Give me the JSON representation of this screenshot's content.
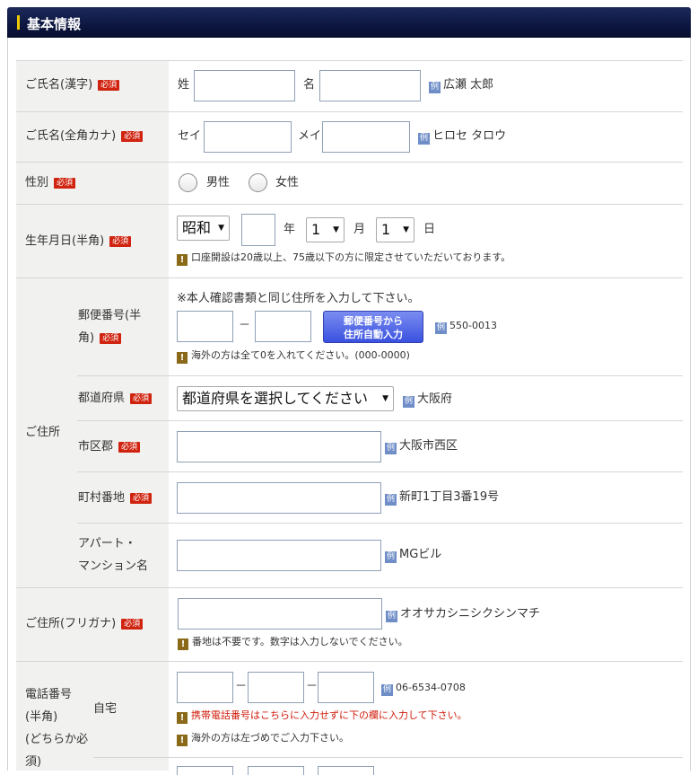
{
  "section_title": "基本情報",
  "required_badge": "必須",
  "example_badge": "例",
  "warn_badge": "!",
  "name_kanji": {
    "label": "ご氏名(漢字)",
    "last_prefix": "姓",
    "first_prefix": "名",
    "example": "広瀬 太郎"
  },
  "name_kana": {
    "label": "ご氏名(全角カナ)",
    "last_prefix": "セイ",
    "first_prefix": "メイ",
    "example": "ヒロセ タロウ"
  },
  "gender": {
    "label": "性別",
    "options": [
      "男性",
      "女性"
    ]
  },
  "birthdate": {
    "label": "生年月日(半角)",
    "era": "昭和",
    "year_unit": "年",
    "month": "1",
    "month_unit": "月",
    "day": "1",
    "day_unit": "日",
    "note": "口座開設は20歳以上、75歳以下の方に限定させていただいております。"
  },
  "address": {
    "label": "ご住所",
    "postal": {
      "label_line1": "郵便番号(半",
      "label_line2": "角)",
      "instruction": "※本人確認書類と同じ住所を入力して下さい。",
      "separator": "－",
      "button_line1": "郵便番号から",
      "button_line2": "住所自動入力",
      "example": "550-0013",
      "note": "海外の方は全て0を入れてください。(000-0000)"
    },
    "prefecture": {
      "label": "都道府県",
      "selected": "都道府県を選択してください",
      "example": "大阪府"
    },
    "city": {
      "label": "市区郡",
      "example": "大阪市西区"
    },
    "town": {
      "label": "町村番地",
      "example": "新町1丁目3番19号"
    },
    "building": {
      "label_line1": "アパート・",
      "label_line2": "マンション名",
      "example": "MGビル"
    }
  },
  "address_kana": {
    "label": "ご住所(フリガナ)",
    "example": "オオサカシニシクシンマチ",
    "note": "番地は不要です。数字は入力しないでください。"
  },
  "phone": {
    "label_lines": [
      "電話番号",
      "(半角)",
      "(どちらか必",
      "須)"
    ],
    "home_label": "自宅",
    "separator": "－",
    "example": "06-6534-0708",
    "note_red": "携帯電話番号はこちらに入力せずに下の欄に入力して下さい。",
    "note": "海外の方は左づめでご入力下さい。"
  },
  "colors": {
    "header_bg": "#0c1640",
    "label_bg": "#f1f1ef",
    "required_red": "#d02410",
    "button_blue": "#3a52e0",
    "warning_text": "#d01a0a"
  }
}
